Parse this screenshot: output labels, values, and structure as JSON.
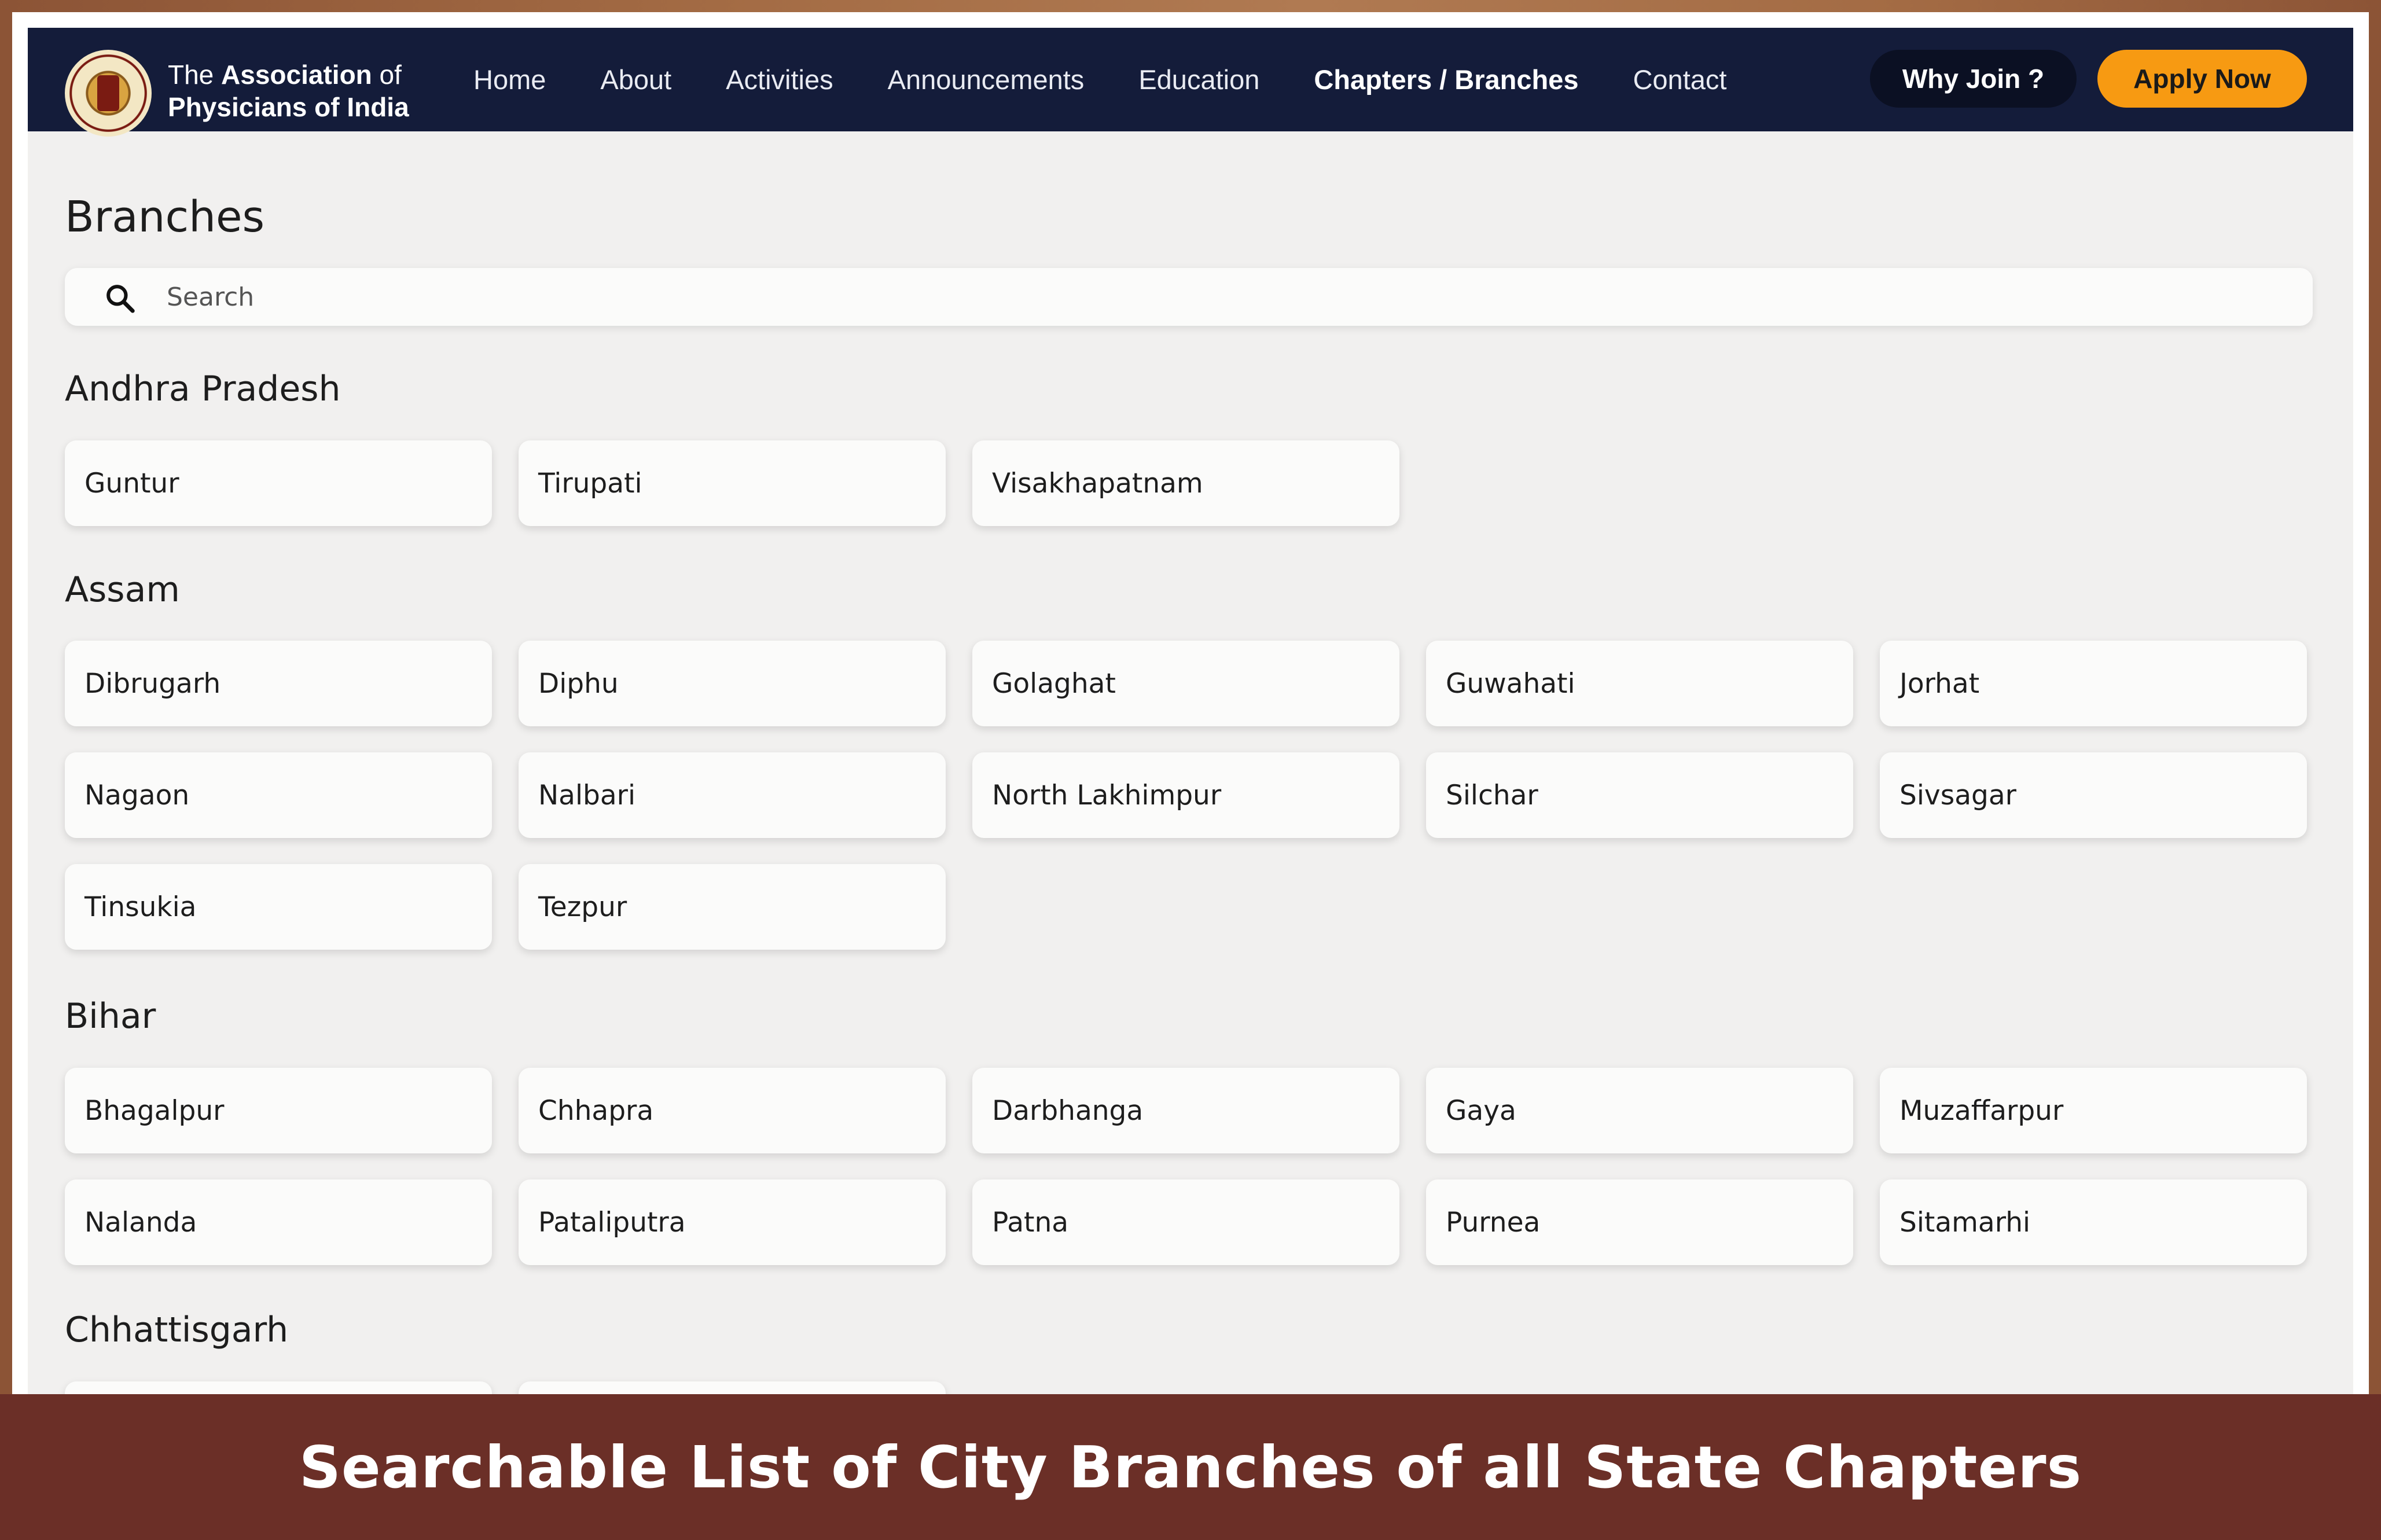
{
  "navbar": {
    "brand_line1_prefix": "The ",
    "brand_line1_bold": "Association",
    "brand_line1_suffix": " of",
    "brand_line2": "Physicians of India",
    "links": [
      {
        "label": "Home",
        "active": false
      },
      {
        "label": "About",
        "active": false
      },
      {
        "label": "Activities",
        "active": false
      },
      {
        "label": "Announcements",
        "active": false
      },
      {
        "label": "Education",
        "active": false
      },
      {
        "label": "Chapters / Branches",
        "active": true
      },
      {
        "label": "Contact",
        "active": false
      }
    ],
    "why_join_label": "Why Join ?",
    "apply_label": "Apply Now"
  },
  "main": {
    "title": "Branches",
    "search": {
      "placeholder": "Search",
      "value": ""
    },
    "states": [
      {
        "name": "Andhra Pradesh",
        "branches": [
          "Guntur",
          "Tirupati",
          "Visakhapatnam"
        ]
      },
      {
        "name": "Assam",
        "branches": [
          "Dibrugarh",
          "Diphu",
          "Golaghat",
          "Guwahati",
          "Jorhat",
          "Nagaon",
          "Nalbari",
          "North Lakhimpur",
          "Silchar",
          "Sivsagar",
          "Tinsukia",
          "Tezpur"
        ]
      },
      {
        "name": "Bihar",
        "branches": [
          "Bhagalpur",
          "Chhapra",
          "Darbhanga",
          "Gaya",
          "Muzaffarpur",
          "Nalanda",
          "Pataliputra",
          "Patna",
          "Purnea",
          "Sitamarhi"
        ]
      },
      {
        "name": "Chhattisgarh",
        "branches": [
          "",
          ""
        ]
      }
    ]
  },
  "caption": "Searchable List of City Branches of all State Chapters",
  "colors": {
    "navbar_bg": "#141c3a",
    "apply_button": "#f79a12",
    "why_join_button": "#0b1023",
    "caption_bg": "#6b2f27",
    "page_bg": "#f1f0ef"
  }
}
